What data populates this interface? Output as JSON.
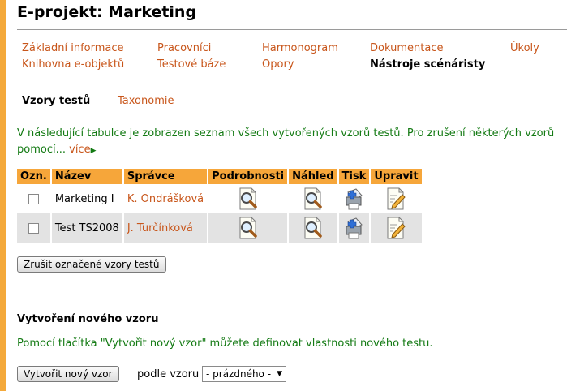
{
  "page": {
    "title": "E-projekt: Marketing"
  },
  "nav": {
    "row1": [
      "Základní informace",
      "Pracovníci",
      "Harmonogram",
      "Dokumentace",
      "Úkoly"
    ],
    "row2": [
      "Knihovna e-objektů",
      "Testové báze",
      "Opory",
      "Nástroje scénáristy"
    ],
    "active": "Nástroje scénáristy"
  },
  "subnav": {
    "items": [
      "Vzory testů",
      "Taxonomie"
    ],
    "active": "Vzory testů"
  },
  "intro": {
    "line1": "V následující tabulce je zobrazen seznam všech vytvořených vzorů testů. Pro zrušení některých vzorů",
    "line2": "pomocí...",
    "more": "více"
  },
  "table": {
    "headers": [
      "Ozn.",
      "Název",
      "Správce",
      "Podrobnosti",
      "Náhled",
      "Tisk",
      "Upravit"
    ],
    "rows": [
      {
        "name": "Marketing I",
        "admin": "K. Ondrášková",
        "checked": false
      },
      {
        "name": "Test TS2008",
        "admin": "J. Turčínková",
        "checked": false
      }
    ]
  },
  "delete_button": "Zrušit označené vzory testů",
  "new_section": {
    "title": "Vytvoření nového vzoru",
    "text": "Pomocí tlačítka \"Vytvořit nový vzor\" můžete definovat vlastnosti nového testu.",
    "create_button": "Vytvořit nový vzor",
    "by_label": "podle vzoru",
    "select_value": "- prázdného -"
  },
  "icons": {
    "details": "magnifier-document-icon",
    "preview": "magnifier-document-icon",
    "print": "print-document-icon",
    "edit": "edit-document-icon"
  },
  "colors": {
    "accent": "#f4a93b",
    "link": "#c8561b",
    "info_text": "#137a13",
    "header_bg": "#f6a63a",
    "alt_row": "#e3e3e3"
  }
}
